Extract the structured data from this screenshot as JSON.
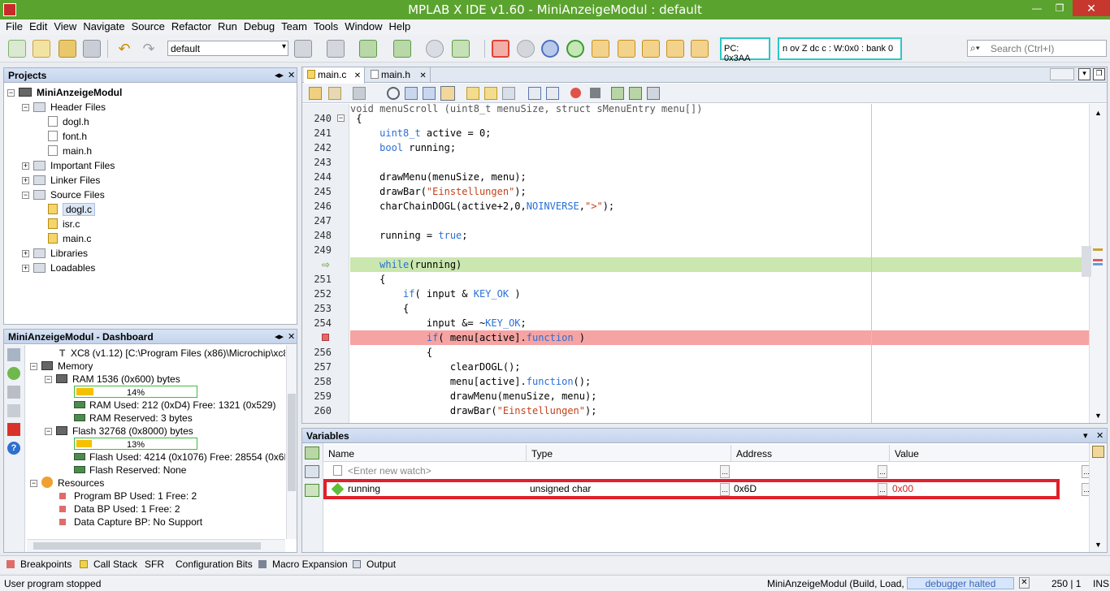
{
  "window": {
    "title": "MPLAB X IDE v1.60 - MiniAnzeigeModul : default",
    "controls": {
      "minimize": "—",
      "maximize": "❐",
      "close": "✕"
    }
  },
  "menu": [
    "File",
    "Edit",
    "View",
    "Navigate",
    "Source",
    "Refactor",
    "Run",
    "Debug",
    "Team",
    "Tools",
    "Window",
    "Help"
  ],
  "toolbar": {
    "configuration": "default",
    "pc_readout": "PC: 0x3AA",
    "status_register": "n ov Z dc c  : W:0x0 : bank 0",
    "search_placeholder": "Search (Ctrl+I)"
  },
  "projects": {
    "title": "Projects",
    "root": "MiniAnzeigeModul",
    "nodes": [
      {
        "label": "Header Files",
        "level": 1,
        "type": "folder",
        "expanded": true
      },
      {
        "label": "dogl.h",
        "level": 2,
        "type": "file"
      },
      {
        "label": "font.h",
        "level": 2,
        "type": "file"
      },
      {
        "label": "main.h",
        "level": 2,
        "type": "file"
      },
      {
        "label": "Important Files",
        "level": 1,
        "type": "folder",
        "expanded": false
      },
      {
        "label": "Linker Files",
        "level": 1,
        "type": "folder",
        "expanded": false
      },
      {
        "label": "Source Files",
        "level": 1,
        "type": "folder",
        "expanded": true
      },
      {
        "label": "dogl.c",
        "level": 2,
        "type": "file",
        "selected": true
      },
      {
        "label": "isr.c",
        "level": 2,
        "type": "file"
      },
      {
        "label": "main.c",
        "level": 2,
        "type": "file"
      },
      {
        "label": "Libraries",
        "level": 1,
        "type": "folder",
        "expanded": false
      },
      {
        "label": "Loadables",
        "level": 1,
        "type": "folder",
        "expanded": false
      }
    ]
  },
  "dashboard": {
    "title": "MiniAnzeigeModul - Dashboard",
    "compiler": "XC8 (v1.12) [C:\\Program Files (x86)\\Microchip\\xc8\\",
    "memory_label": "Memory",
    "ram_label": "RAM 1536 (0x600) bytes",
    "ram_percent": 14,
    "ram_percent_text": "14%",
    "ram_used": "RAM Used: 212 (0xD4) Free: 1321 (0x529)",
    "ram_reserved": "RAM Reserved: 3 bytes",
    "flash_label": "Flash 32768 (0x8000) bytes",
    "flash_percent": 13,
    "flash_percent_text": "13%",
    "flash_used": "Flash Used: 4214 (0x1076) Free: 28554 (0x6F8",
    "flash_reserved": "Flash Reserved: None",
    "resources_label": "Resources",
    "program_bp": "Program BP Used: 1  Free: 2",
    "data_bp": "Data BP Used: 1  Free: 2",
    "data_capture": "Data Capture BP: No Support"
  },
  "editor": {
    "tabs": [
      "main.c",
      "main.h"
    ],
    "top_partial": "void menuScroll (uint8_t menuSize, struct sMenuEntry menu[])",
    "lines": [
      {
        "n": "240",
        "code": "{"
      },
      {
        "n": "241",
        "code": "    uint8_t active = 0;"
      },
      {
        "n": "242",
        "code": "    bool running;"
      },
      {
        "n": "243",
        "code": ""
      },
      {
        "n": "244",
        "code": "    drawMenu(menuSize, menu);"
      },
      {
        "n": "245",
        "code": "    drawBar(\"Einstellungen\");"
      },
      {
        "n": "246",
        "code": "    charChainDOGL(active+2,0,NOINVERSE,\">\");"
      },
      {
        "n": "247",
        "code": ""
      },
      {
        "n": "248",
        "code": "    running = true;"
      },
      {
        "n": "249",
        "code": ""
      },
      {
        "n": "",
        "code": "    while(running)",
        "marker": "pc"
      },
      {
        "n": "251",
        "code": "    {"
      },
      {
        "n": "252",
        "code": "        if( input & KEY_OK )"
      },
      {
        "n": "253",
        "code": "        {"
      },
      {
        "n": "254",
        "code": "            input &= ~KEY_OK;"
      },
      {
        "n": "",
        "code": "            if( menu[active].function )",
        "marker": "bp"
      },
      {
        "n": "256",
        "code": "            {"
      },
      {
        "n": "257",
        "code": "                clearDOGL();"
      },
      {
        "n": "258",
        "code": "                menu[active].function();"
      },
      {
        "n": "259",
        "code": "                drawMenu(menuSize, menu);"
      },
      {
        "n": "260",
        "code": "                drawBar(\"Einstellungen\");"
      }
    ]
  },
  "variables": {
    "title": "Variables",
    "columns": [
      "Name",
      "Type",
      "Address",
      "Value"
    ],
    "new_watch_placeholder": "<Enter new watch>",
    "rows": [
      {
        "name": "running",
        "type": "unsigned char",
        "address": "0x6D",
        "value": "0x00"
      }
    ],
    "highlight_color": "#e0202a"
  },
  "bottom_tabs": [
    "Breakpoints",
    "Call Stack",
    "SFR",
    "Configuration Bits",
    "Macro Expansion",
    "Output"
  ],
  "status": {
    "message": "User program stopped",
    "build": "MiniAnzeigeModul (Build, Load, ...)",
    "debugger": "debugger halted",
    "position": "250 | 1",
    "mode": "INS"
  }
}
